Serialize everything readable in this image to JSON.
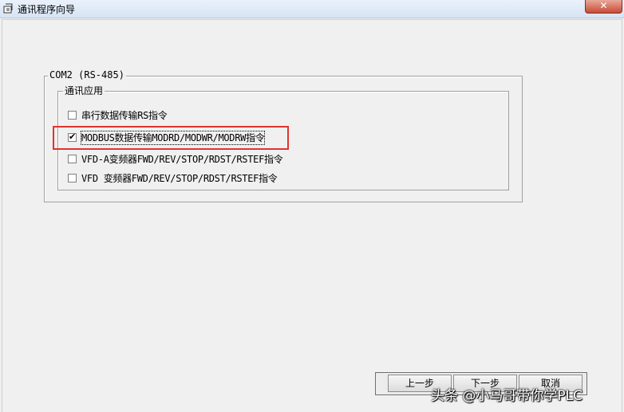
{
  "window": {
    "title": "通讯程序向导",
    "close_label": "✕"
  },
  "com_group": {
    "legend": "COM2 (RS-485)"
  },
  "comm_group": {
    "legend": "通讯应用",
    "options": [
      {
        "label": "串行数据传输RS指令",
        "checked": false
      },
      {
        "label": "MODBUS数据传输MODRD/MODWR/MODRW指令",
        "checked": true
      },
      {
        "label": "VFD-A变频器FWD/REV/STOP/RDST/RSTEF指令",
        "checked": false
      },
      {
        "label": "VFD 变频器FWD/REV/STOP/RDST/RSTEF指令",
        "checked": false
      }
    ]
  },
  "buttons": {
    "prev": "上一步",
    "next": "下一步",
    "cancel": "取消"
  },
  "watermark": "头条 @小马哥带你学PLC",
  "colors": {
    "highlight": "#e0332f",
    "close_button": "#c74a35"
  }
}
